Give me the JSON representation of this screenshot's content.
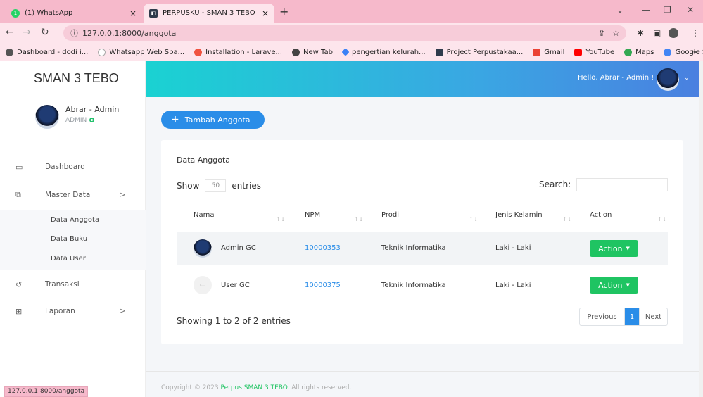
{
  "browser": {
    "tabs": [
      {
        "label": "(1) WhatsApp",
        "close": "×",
        "icon_color": "#25d366"
      },
      {
        "label": "PERPUSKU - SMAN 3 TEBO",
        "close": "×",
        "icon_color": "#2f3b4c"
      }
    ],
    "new_tab": "+",
    "url": "127.0.0.1:8000/anggota",
    "bookmarks": [
      {
        "label": "Dashboard - dodi i...",
        "color": "#555555"
      },
      {
        "label": "Whatsapp Web Spa...",
        "color": "#ffffff"
      },
      {
        "label": "Installation - Larave...",
        "color": "#f05340"
      },
      {
        "label": "New Tab",
        "color": "#444444"
      },
      {
        "label": "pengertian kelurah...",
        "color": "#3b82f6"
      },
      {
        "label": "Project Perpustakaa...",
        "color": "#2f3b4c"
      },
      {
        "label": "Gmail",
        "color": "#ea4335"
      },
      {
        "label": "YouTube",
        "color": "#ff0000"
      },
      {
        "label": "Maps",
        "color": "#34a853"
      },
      {
        "label": "Google Sky",
        "color": "#4285f4"
      }
    ],
    "more_bookmarks": "»",
    "status_url": "127.0.0.1:8000/anggota"
  },
  "sidebar": {
    "brand": "SMAN 3 TEBO",
    "user": {
      "name": "Abrar - Admin",
      "role": "ADMIN"
    },
    "menu": [
      {
        "label": "Dashboard",
        "icon": "monitor-icon"
      },
      {
        "label": "Master Data",
        "icon": "copy-icon",
        "arrow": ">"
      },
      {
        "label": "Transaksi",
        "icon": "history-icon"
      },
      {
        "label": "Laporan",
        "icon": "table-icon",
        "arrow": ">"
      }
    ],
    "submenu": [
      "Data Anggota",
      "Data Buku",
      "Data User"
    ]
  },
  "header": {
    "greeting": "Hello, Abrar - Admin !"
  },
  "main": {
    "add_button": "Tambah Anggota",
    "card_title": "Data Anggota",
    "show_label": "Show",
    "entries_value": "50",
    "entries_label": "entries",
    "search_label": "Search:",
    "columns": [
      "Nama",
      "NPM",
      "Prodi",
      "Jenis Kelamin",
      "Action"
    ],
    "rows": [
      {
        "nama": "Admin GC",
        "npm": "10000353",
        "prodi": "Teknik Informatika",
        "jk": "Laki - Laki",
        "action": "Action"
      },
      {
        "nama": "User GC",
        "npm": "10000375",
        "prodi": "Teknik Informatika",
        "jk": "Laki - Laki",
        "action": "Action"
      }
    ],
    "info": "Showing 1 to 2 of 2 entries",
    "pager": {
      "prev": "Previous",
      "current": "1",
      "next": "Next"
    }
  },
  "footer": {
    "prefix": "Copyright © 2023 ",
    "brand": "Perpus SMAN 3 TEBO",
    "suffix": ". All rights reserved."
  },
  "colors": {
    "accent": "#2a8de8",
    "success": "#1fc462"
  }
}
